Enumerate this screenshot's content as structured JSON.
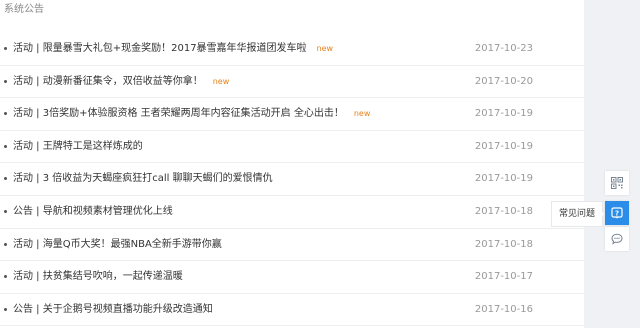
{
  "section": {
    "title": "系统公告"
  },
  "announcements": [
    {
      "title": "活动 | 限量暴雪大礼包+现金奖励！2017暴雪嘉年华报道团发车啦",
      "badge": "new",
      "date": "2017-10-23"
    },
    {
      "title": "活动 | 动漫新番征集令，双倍收益等你拿！",
      "badge": "new",
      "date": "2017-10-20"
    },
    {
      "title": "活动 | 3倍奖励+体验服资格 王者荣耀两周年内容征集活动开启 全心出击！",
      "badge": "new",
      "date": "2017-10-19"
    },
    {
      "title": "活动 | 王牌特工是这样炼成的",
      "badge": "",
      "date": "2017-10-19"
    },
    {
      "title": "活动 | 3 倍收益为天蝎座疯狂打call 聊聊天蝎们的爱恨情仇",
      "badge": "",
      "date": "2017-10-19"
    },
    {
      "title": "公告 | 导航和视频素材管理优化上线",
      "badge": "",
      "date": "2017-10-18"
    },
    {
      "title": "活动 | 海量Q币大奖！最强NBA全新手游带你赢",
      "badge": "",
      "date": "2017-10-18"
    },
    {
      "title": "活动 | 扶贫集结号吹响，一起传递温暖",
      "badge": "",
      "date": "2017-10-17"
    },
    {
      "title": "公告 | 关于企鹅号视频直播功能升级改造通知",
      "badge": "",
      "date": "2017-10-16"
    }
  ],
  "sidebar": {
    "tooltip": "常见问题",
    "buttons": [
      {
        "icon": "qr-code-icon"
      },
      {
        "icon": "faq-icon"
      },
      {
        "icon": "chat-bubble-icon"
      }
    ],
    "accent_color": "#2b8de8",
    "panel_color": "#eff1f4"
  },
  "colors": {
    "badge": "#e8821e",
    "date": "#999999",
    "text": "#333333"
  }
}
